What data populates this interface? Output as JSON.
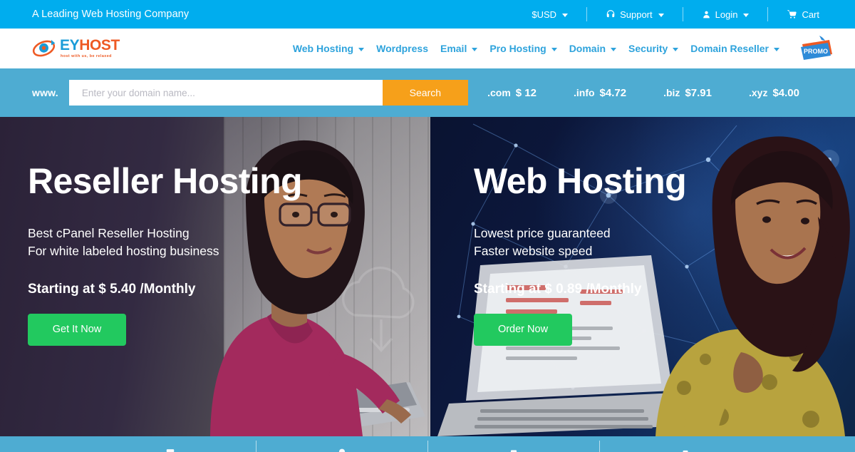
{
  "topbar": {
    "tagline": "A Leading Web Hosting Company",
    "items": [
      {
        "label": "$USD",
        "icon": "",
        "caret": true
      },
      {
        "label": "Support",
        "icon": "headset-icon",
        "caret": true
      },
      {
        "label": "Login",
        "icon": "user-icon",
        "caret": true
      },
      {
        "label": "Cart",
        "icon": "cart-icon",
        "caret": false
      }
    ]
  },
  "brand": {
    "name_part1": "EY",
    "name_part2": "HOST",
    "tagline": "host with us, be relaxed"
  },
  "nav": {
    "items": [
      {
        "label": "Web Hosting",
        "caret": true
      },
      {
        "label": "Wordpress",
        "caret": false
      },
      {
        "label": "Email",
        "caret": true
      },
      {
        "label": "Pro Hosting",
        "caret": true
      },
      {
        "label": "Domain",
        "caret": true
      },
      {
        "label": "Security",
        "caret": true
      },
      {
        "label": "Domain Reseller",
        "caret": true
      }
    ],
    "promo_label": "PROMO"
  },
  "search": {
    "prefix": "www.",
    "placeholder": "Enter your domain name...",
    "value": "",
    "button_label": "Search",
    "tlds": [
      {
        "name": ".com",
        "price": "$ 12"
      },
      {
        "name": ".info",
        "price": "$4.72"
      },
      {
        "name": ".biz",
        "price": "$7.91"
      },
      {
        "name": ".xyz",
        "price": "$4.00"
      }
    ]
  },
  "hero": {
    "left": {
      "title": "Reseller Hosting",
      "sub_line1": "Best cPanel Reseller Hosting",
      "sub_line2": "For white labeled hosting business",
      "price": "Starting at $ 5.40 /Monthly",
      "cta_label": "Get It Now"
    },
    "right": {
      "title": "Web Hosting",
      "sub_line1": "Lowest price guaranteed",
      "sub_line2": "Faster website speed",
      "price": "Starting at $ 0.89 /Monthly",
      "cta_label": "Order Now"
    }
  },
  "colors": {
    "topbar": "#00ADEE",
    "search_band": "#4EACD2",
    "search_button": "#F6A01A",
    "nav_link": "#2EA3DC",
    "cta_green": "#22C95F",
    "brand_blue": "#1B9CD8",
    "brand_orange": "#EE5A24"
  }
}
